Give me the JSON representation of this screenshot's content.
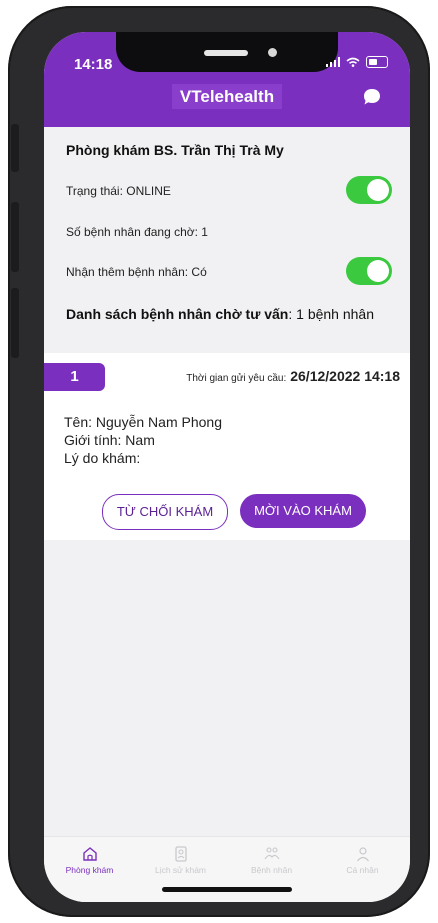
{
  "status_bar": {
    "time": "14:18"
  },
  "header": {
    "title": "VTelehealth",
    "chat_icon": "chat-bubble-icon"
  },
  "clinic": {
    "name": "Phòng khám BS. Trần Thị Trà My",
    "status_label": "Trạng thái: ONLINE",
    "status_toggle": true,
    "waiting_label": "Số bệnh nhân đang chờ: 1",
    "accept_label": "Nhận thêm bệnh nhân: Có",
    "accept_toggle": true,
    "list_title_bold": "Danh sách bệnh nhân chờ tư vấn",
    "list_title_rest": ": 1 bệnh nhân"
  },
  "patient_card": {
    "number": "1",
    "time_label": "Thời gian gửi yêu cầu:",
    "time_value": "26/12/2022 14:18",
    "name": "Tên: Nguyễn Nam Phong",
    "gender": "Giới tính: Nam",
    "reason": "Lý do khám:",
    "reject_button": "TỪ CHỐI KHÁM",
    "accept_button": "MỜI VÀO KHÁM"
  },
  "tabs": [
    {
      "label": "Phòng khám",
      "icon": "home-icon",
      "active": true
    },
    {
      "label": "Lịch sử khám",
      "icon": "history-icon",
      "active": false
    },
    {
      "label": "Bệnh nhân",
      "icon": "patients-icon",
      "active": false
    },
    {
      "label": "Cá nhân",
      "icon": "person-icon",
      "active": false
    }
  ],
  "colors": {
    "primary": "#7b2fbe",
    "toggle_on": "#3ac93f",
    "background": "#f1f1f3"
  }
}
